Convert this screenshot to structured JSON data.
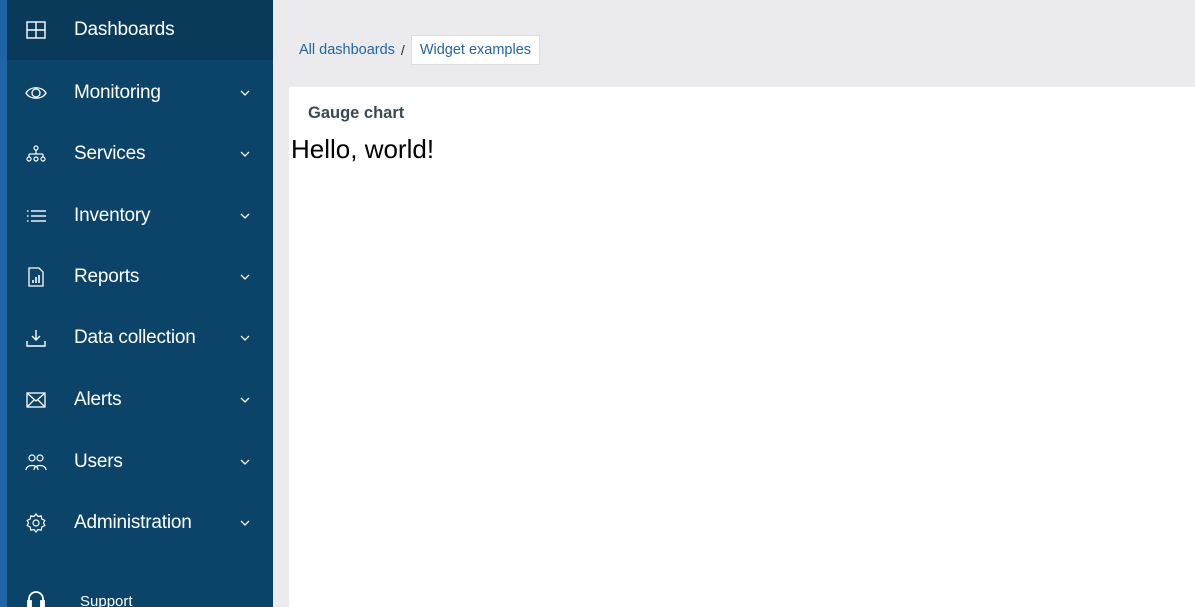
{
  "sidebar": {
    "items": [
      {
        "label": "Dashboards",
        "icon": "dashboard-grid-icon",
        "active": true
      },
      {
        "label": "Monitoring",
        "icon": "eye-icon"
      },
      {
        "label": "Services",
        "icon": "hierarchy-icon"
      },
      {
        "label": "Inventory",
        "icon": "list-icon"
      },
      {
        "label": "Reports",
        "icon": "report-icon"
      },
      {
        "label": "Data collection",
        "icon": "download-icon"
      },
      {
        "label": "Alerts",
        "icon": "envelope-icon"
      },
      {
        "label": "Users",
        "icon": "users-icon"
      },
      {
        "label": "Administration",
        "icon": "gear-icon"
      }
    ],
    "support": {
      "label": "Support",
      "icon": "headset-icon"
    }
  },
  "breadcrumb": {
    "parent": "All dashboards",
    "separator": "/",
    "current": "Widget examples"
  },
  "widget": {
    "title": "Gauge chart",
    "content": "Hello, world!"
  },
  "colors": {
    "sidebar_bg": "#0b4468",
    "sidebar_active_bg": "#0a3a59",
    "accent": "#1f65a6",
    "main_bg": "#ebebed"
  }
}
